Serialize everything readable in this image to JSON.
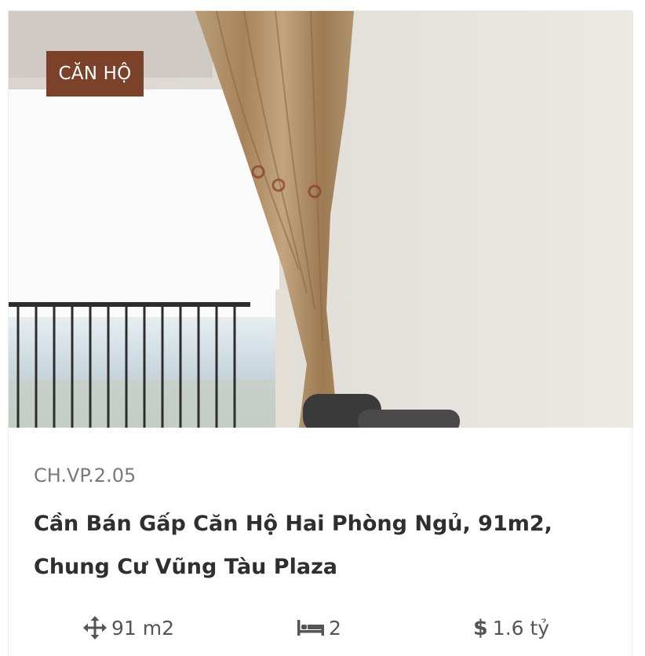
{
  "listing": {
    "category_badge": "CĂN HỘ",
    "code": "CH.VP.2.05",
    "title": "Cần Bán Gấp Căn Hộ Hai Phòng Ngủ, 91m2, Chung Cư Vũng Tàu Plaza",
    "area": "91 m2",
    "bedrooms": "2",
    "price": "1.6 tỷ"
  },
  "icons": {
    "area": "move-arrows-icon",
    "bedrooms": "bed-icon",
    "price": "dollar-icon"
  },
  "colors": {
    "badge_bg": "#7b4129",
    "title_text": "#2f2f2f",
    "meta_text": "#555555"
  }
}
